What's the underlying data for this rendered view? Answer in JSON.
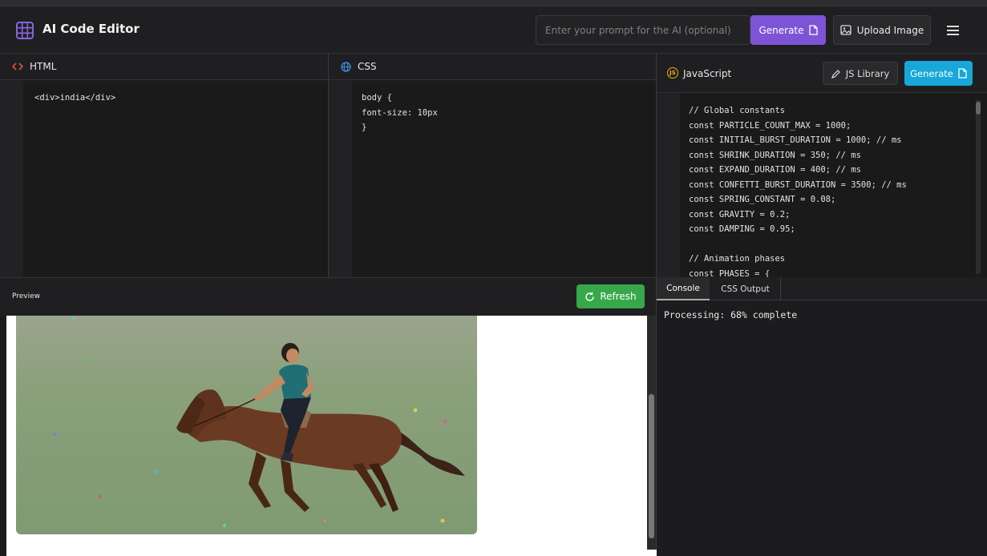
{
  "header": {
    "app_title": "AI Code Editor",
    "prompt_placeholder": "Enter your prompt for the AI (optional)",
    "generate_label": "Generate",
    "upload_label": "Upload Image"
  },
  "panels": {
    "html": {
      "title": "HTML",
      "code": "<div>india</div>"
    },
    "css": {
      "title": "CSS",
      "code": "body {\nfont-size: 10px\n}"
    },
    "js": {
      "title": "JavaScript",
      "library_label": "JS Library",
      "generate_label": "Generate",
      "code": "// Global constants\nconst PARTICLE_COUNT_MAX = 1000;\nconst INITIAL_BURST_DURATION = 1000; // ms\nconst SHRINK_DURATION = 350; // ms\nconst EXPAND_DURATION = 400; // ms\nconst CONFETTI_BURST_DURATION = 3500; // ms\nconst SPRING_CONSTANT = 0.08;\nconst GRAVITY = 0.2;\nconst DAMPING = 0.95;\n\n// Animation phases\nconst PHASES = {"
    }
  },
  "preview": {
    "label": "Preview",
    "refresh_label": "Refresh"
  },
  "output_tabs": [
    {
      "label": "Console",
      "active": true
    },
    {
      "label": "CSS Output",
      "active": false
    }
  ],
  "console": {
    "message": "Processing: 68% complete"
  },
  "colors": {
    "generate_purple": "#7e54d6",
    "generate_blue": "#17a7d8",
    "refresh_green": "#36a84a",
    "html_icon": "#e0533d",
    "css_icon": "#3d8fe0",
    "js_icon": "#e7b21a"
  },
  "icons": {
    "logo": "grid-icon",
    "generate": "document-icon",
    "upload": "image-icon",
    "menu": "hamburger-icon",
    "html": "code-brackets-icon",
    "css": "globe-icon",
    "js": "js-circle-icon",
    "js_library": "edit-icon",
    "refresh": "refresh-icon"
  }
}
